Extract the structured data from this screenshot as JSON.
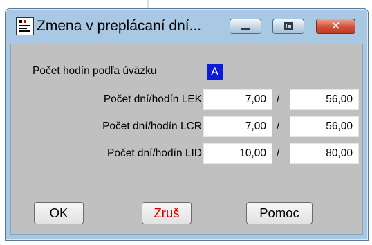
{
  "window": {
    "title": "Zmena v preplácaní dní...",
    "close_glyph": "✕"
  },
  "form": {
    "uvazok_label": "Počet hodín podľa úväzku",
    "uvazok_value": "A",
    "rows": [
      {
        "label": "Počet dní/hodín LEK",
        "days": "7,00",
        "separator": "/",
        "hours": "56,00"
      },
      {
        "label": "Počet dní/hodín LCR",
        "days": "7,00",
        "separator": "/",
        "hours": "56,00"
      },
      {
        "label": "Počet dní/hodín LID",
        "days": "10,00",
        "separator": "/",
        "hours": "80,00"
      }
    ]
  },
  "buttons": {
    "ok": "OK",
    "cancel": "Zruš",
    "help": "Pomoc"
  },
  "colors": {
    "client_bg": "#c0c0c0",
    "frame": "#a9c8e3",
    "flag_bg": "#0b1bd9",
    "cancel_text": "#d40000",
    "close_button": "#c23a22"
  },
  "icons": [
    "app-icon",
    "minimize-icon",
    "maximize-icon",
    "close-icon"
  ]
}
